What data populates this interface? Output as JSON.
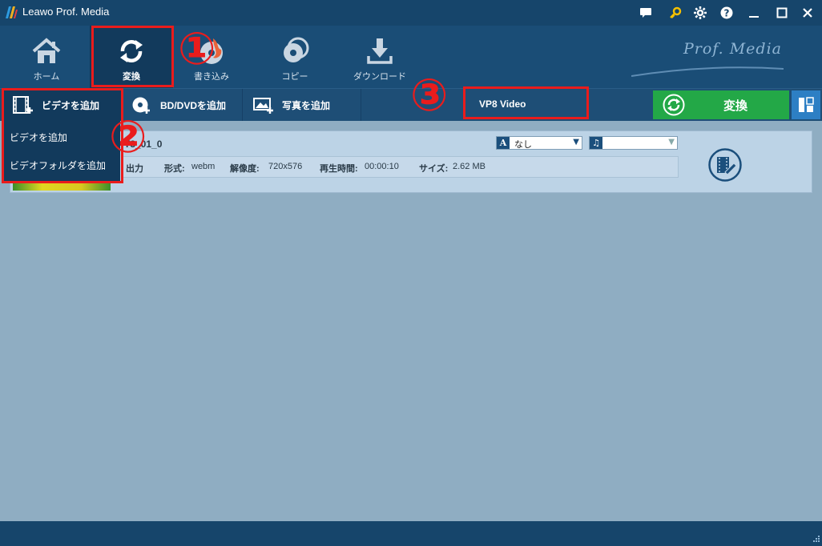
{
  "window": {
    "title": "Leawo Prof. Media",
    "brand": "Prof. Media",
    "controls": [
      "chat-icon",
      "key-icon",
      "gear-icon",
      "help-icon",
      "minimize-icon",
      "maximize-icon",
      "close-icon"
    ]
  },
  "nav": {
    "items": [
      {
        "label": "ホーム",
        "icon": "home-icon"
      },
      {
        "label": "変換",
        "icon": "convert-icon",
        "active": true
      },
      {
        "label": "書き込み",
        "icon": "burn-icon"
      },
      {
        "label": "コピー",
        "icon": "copy-icon"
      },
      {
        "label": "ダウンロード",
        "icon": "download-icon"
      }
    ]
  },
  "toolbar": {
    "add_video": "ビデオを追加",
    "add_bd_dvd": "BD/DVDを追加",
    "add_photo": "写真を追加",
    "profile": "VP8 Video",
    "convert": "変換"
  },
  "dropdown": {
    "items": [
      "ビデオを追加",
      "ビデオフォルダを追加"
    ]
  },
  "file": {
    "name": "T3_01_0",
    "subtitle": "なし",
    "audio": "",
    "output_label": "出力",
    "format_label": "形式:",
    "format": "webm",
    "resolution_label": "解像度:",
    "resolution": "720x576",
    "duration_label": "再生時間:",
    "duration": "00:00:10",
    "size_label": "サイズ:",
    "size": "2.62 MB"
  },
  "annotations": [
    "①",
    "②",
    "③"
  ],
  "colors": {
    "titlebar": "#16456b",
    "nav": "#1a4d76",
    "active": "#123a5c",
    "convert_green": "#23a847",
    "annotation_red": "#ea1c1c",
    "content_bg": "#8fadc2"
  }
}
